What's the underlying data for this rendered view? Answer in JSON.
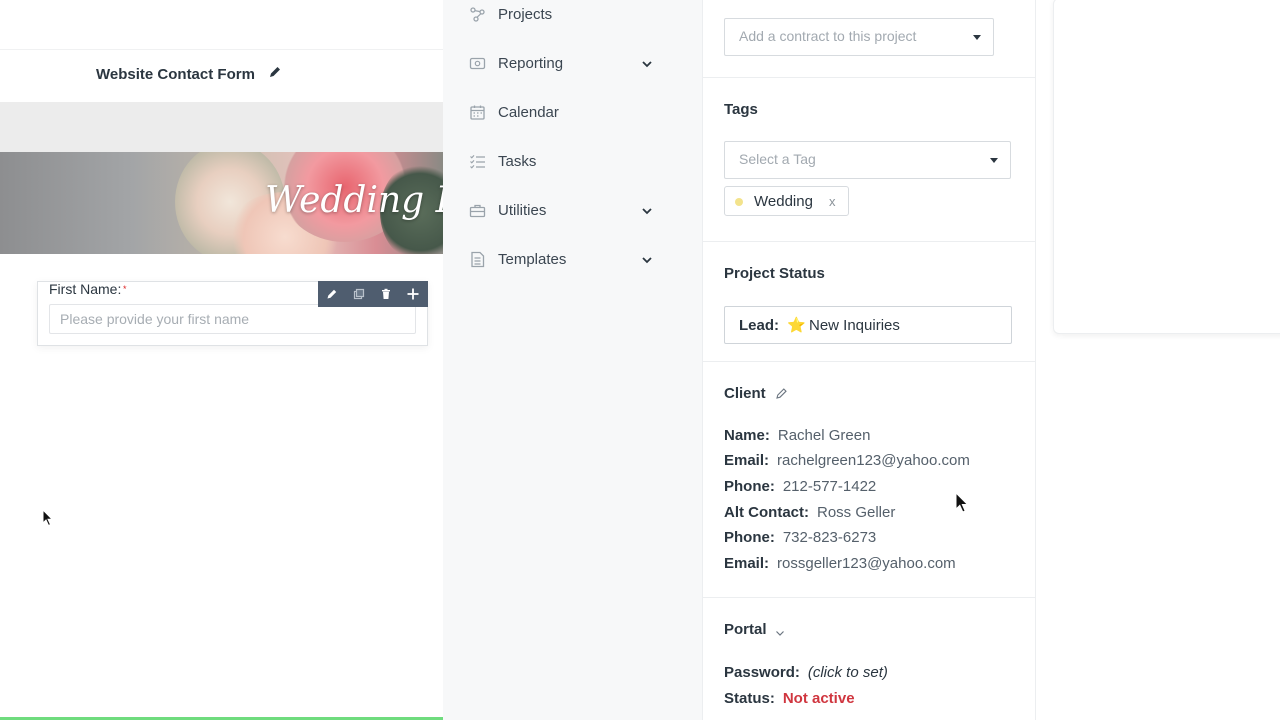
{
  "form": {
    "title": "Website Contact Form",
    "banner_text": "Wedding Inq",
    "field_label": "First Name:",
    "field_required_mark": "*",
    "field_placeholder": "Please provide your first name",
    "toolbar_icons": [
      "pencil-icon",
      "duplicate-icon",
      "trash-icon",
      "plus-icon"
    ]
  },
  "nav": {
    "items": [
      {
        "label": "Projects",
        "icon": "projects-icon",
        "has_chevron": false
      },
      {
        "label": "Reporting",
        "icon": "reporting-icon",
        "has_chevron": true
      },
      {
        "label": "Calendar",
        "icon": "calendar-icon",
        "has_chevron": false
      },
      {
        "label": "Tasks",
        "icon": "tasks-icon",
        "has_chevron": false
      },
      {
        "label": "Utilities",
        "icon": "utilities-icon",
        "has_chevron": true
      },
      {
        "label": "Templates",
        "icon": "templates-icon",
        "has_chevron": true
      }
    ]
  },
  "panel": {
    "contract": {
      "placeholder": "Add a contract to this project"
    },
    "tags": {
      "title": "Tags",
      "placeholder": "Select a Tag",
      "selected": [
        {
          "label": "Wedding",
          "remove": "x",
          "dot_color": "#f3e38c"
        }
      ]
    },
    "status": {
      "title": "Project Status",
      "prefix": "Lead:",
      "star": "⭐",
      "value": "New Inquiries"
    },
    "client": {
      "title": "Client",
      "rows": [
        {
          "key": "Name:",
          "value": "Rachel Green"
        },
        {
          "key": "Email:",
          "value": "rachelgreen123@yahoo.com"
        },
        {
          "key": "Phone:",
          "value": "212-577-1422"
        },
        {
          "key": "Alt Contact:",
          "value": "Ross Geller"
        },
        {
          "key": "Phone:",
          "value": "732-823-6273"
        },
        {
          "key": "Email:",
          "value": "rossgeller123@yahoo.com"
        }
      ]
    },
    "portal": {
      "title": "Portal",
      "password_key": "Password:",
      "password_value": "(click to set)",
      "status_key": "Status:",
      "status_value": "Not active",
      "status_color": "#d0363f"
    }
  }
}
